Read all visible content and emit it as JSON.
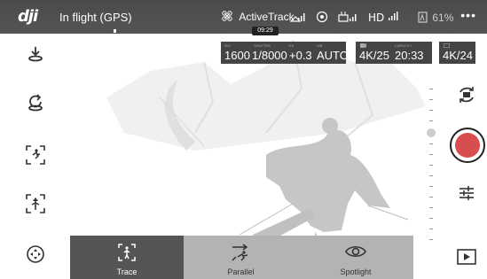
{
  "topbar": {
    "brand": "dji",
    "status": "In flight (GPS)",
    "mode_name": "ActiveTrack",
    "timer": "09:29",
    "signal_icons": [
      "satellite-icon",
      "obstacle-icon",
      "remote-signal-icon",
      "hd-signal-icon"
    ],
    "remote_label": "",
    "hd_label": "HD",
    "battery_percent": "61%",
    "more_label": "•••"
  },
  "camera": {
    "iso_label": "ISO",
    "iso_value": "1600",
    "shutter_label": "SHUTTER",
    "shutter_value": "1/8000",
    "ev_label": "EV",
    "ev_value": "+0.3",
    "wb_label": "WB",
    "wb_value": "AUTO",
    "video_res": "4K/25",
    "capacity_label": "CAPACITY",
    "capacity_value": "20:33",
    "other_res": "4K/24"
  },
  "left_tools": [
    "takeoff-icon",
    "return-home-icon",
    "tracking-icon",
    "tap-fly-icon",
    "navigation-icon"
  ],
  "right_tools": [
    "camera-switch-icon",
    "record-button",
    "settings-sliders-icon",
    "playback-icon"
  ],
  "modes": [
    {
      "label": "Trace",
      "icon": "trace-icon"
    },
    {
      "label": "Parallel",
      "icon": "parallel-icon"
    },
    {
      "label": "Spotlight",
      "icon": "spotlight-icon"
    }
  ],
  "colors": {
    "topbar": "#4a4a4a",
    "record": "#d84d4d",
    "mode_selected": "#555555",
    "mode_unselected": "#b3b3b3"
  }
}
